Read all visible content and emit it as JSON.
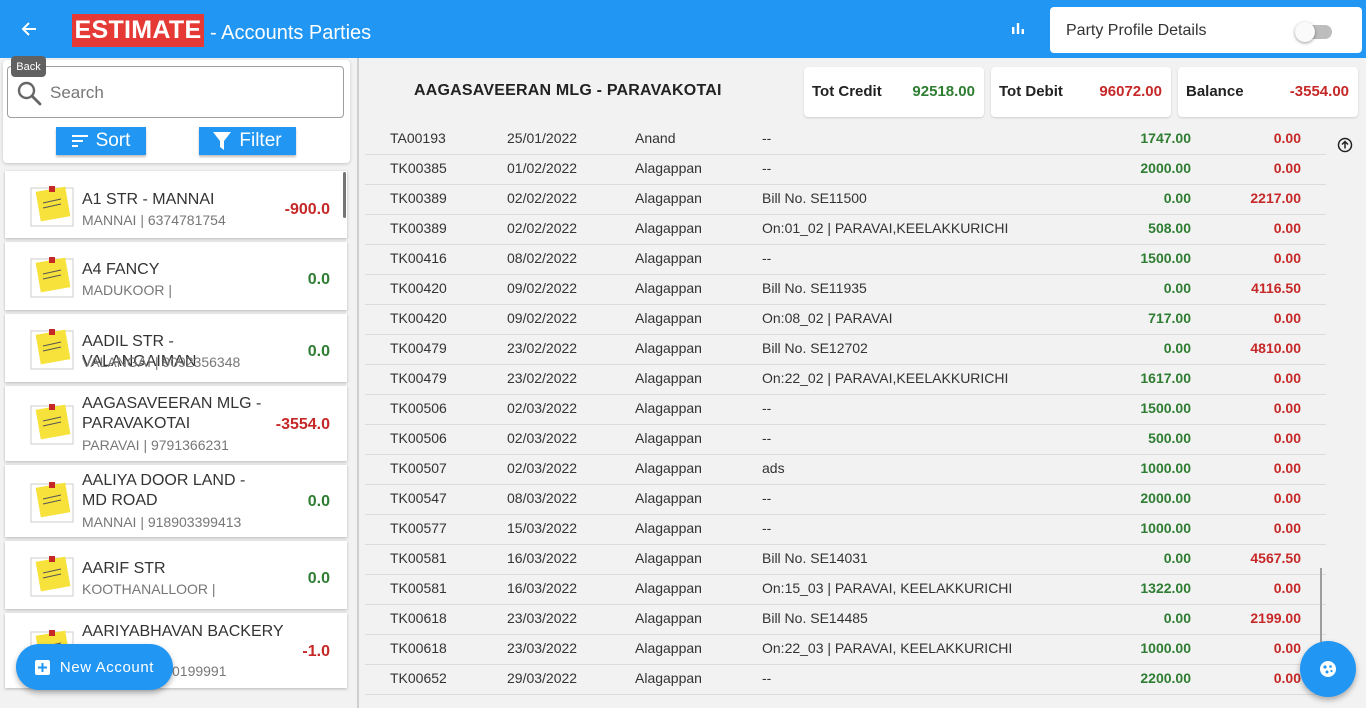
{
  "header": {
    "back_tooltip": "Back",
    "logo_text": "ESTIMATE",
    "title": "- Accounts Parties",
    "profile_toggle_label": "Party Profile Details",
    "profile_toggle_on": false
  },
  "sidebar": {
    "search_placeholder": "Search",
    "sort_label": "Sort",
    "filter_label": "Filter",
    "new_account_label": "New Account",
    "parties": [
      {
        "name": "A1 STR - MANNAI",
        "sub": "MANNAI | 6374781754",
        "amount": "-900.0"
      },
      {
        "name": "A4 FANCY",
        "sub": "MADUKOOR |",
        "amount": "0.0"
      },
      {
        "name": "AADIL STR - VALANGAIMAN",
        "sub": "VALANGAI | 9092356348",
        "amount": "0.0"
      },
      {
        "name": "AAGASAVEERAN MLG - PARAVAKOTAI",
        "sub": "PARAVAI | 9791366231",
        "amount": "-3554.0"
      },
      {
        "name": "AALIYA DOOR LAND - MD ROAD",
        "sub": "MANNAI | 918903399413",
        "amount": "0.0"
      },
      {
        "name": "AARIF STR",
        "sub": "KOOTHANALLOOR |",
        "amount": "0.0"
      },
      {
        "name": "AARIYABHAVAN BACKERY -",
        "sub": "0199991",
        "amount": "-1.0"
      }
    ]
  },
  "account": {
    "name": "AAGASAVEERAN MLG - PARAVAKOTAI",
    "tot_credit_label": "Tot Credit",
    "tot_credit": "92518.00",
    "tot_debit_label": "Tot Debit",
    "tot_debit": "96072.00",
    "balance_label": "Balance",
    "balance": "-3554.00"
  },
  "ledger": [
    {
      "ref": "TA00193",
      "date": "25/01/2022",
      "by": "Anand",
      "desc": "--",
      "credit": "1747.00",
      "debit": "0.00"
    },
    {
      "ref": "TK00385",
      "date": "01/02/2022",
      "by": "Alagappan",
      "desc": "--",
      "credit": "2000.00",
      "debit": "0.00"
    },
    {
      "ref": "TK00389",
      "date": "02/02/2022",
      "by": "Alagappan",
      "desc": "Bill No. SE11500",
      "credit": "0.00",
      "debit": "2217.00"
    },
    {
      "ref": "TK00389",
      "date": "02/02/2022",
      "by": "Alagappan",
      "desc": "On:01_02 | PARAVAI,KEELAKKURICHI",
      "credit": "508.00",
      "debit": "0.00"
    },
    {
      "ref": "TK00416",
      "date": "08/02/2022",
      "by": "Alagappan",
      "desc": "--",
      "credit": "1500.00",
      "debit": "0.00"
    },
    {
      "ref": "TK00420",
      "date": "09/02/2022",
      "by": "Alagappan",
      "desc": "Bill No. SE11935",
      "credit": "0.00",
      "debit": "4116.50"
    },
    {
      "ref": "TK00420",
      "date": "09/02/2022",
      "by": "Alagappan",
      "desc": "On:08_02 | PARAVAI",
      "credit": "717.00",
      "debit": "0.00"
    },
    {
      "ref": "TK00479",
      "date": "23/02/2022",
      "by": "Alagappan",
      "desc": "Bill No. SE12702",
      "credit": "0.00",
      "debit": "4810.00"
    },
    {
      "ref": "TK00479",
      "date": "23/02/2022",
      "by": "Alagappan",
      "desc": "On:22_02 | PARAVAI,KEELAKKURICHI",
      "credit": "1617.00",
      "debit": "0.00"
    },
    {
      "ref": "TK00506",
      "date": "02/03/2022",
      "by": "Alagappan",
      "desc": "--",
      "credit": "1500.00",
      "debit": "0.00"
    },
    {
      "ref": "TK00506",
      "date": "02/03/2022",
      "by": "Alagappan",
      "desc": "--",
      "credit": "500.00",
      "debit": "0.00"
    },
    {
      "ref": "TK00507",
      "date": "02/03/2022",
      "by": "Alagappan",
      "desc": "ads",
      "credit": "1000.00",
      "debit": "0.00"
    },
    {
      "ref": "TK00547",
      "date": "08/03/2022",
      "by": "Alagappan",
      "desc": "--",
      "credit": "2000.00",
      "debit": "0.00"
    },
    {
      "ref": "TK00577",
      "date": "15/03/2022",
      "by": "Alagappan",
      "desc": "--",
      "credit": "1000.00",
      "debit": "0.00"
    },
    {
      "ref": "TK00581",
      "date": "16/03/2022",
      "by": "Alagappan",
      "desc": "Bill No. SE14031",
      "credit": "0.00",
      "debit": "4567.50"
    },
    {
      "ref": "TK00581",
      "date": "16/03/2022",
      "by": "Alagappan",
      "desc": "On:15_03 | PARAVAI, KEELAKKURICHI",
      "credit": "1322.00",
      "debit": "0.00"
    },
    {
      "ref": "TK00618",
      "date": "23/03/2022",
      "by": "Alagappan",
      "desc": "Bill No. SE14485",
      "credit": "0.00",
      "debit": "2199.00"
    },
    {
      "ref": "TK00618",
      "date": "23/03/2022",
      "by": "Alagappan",
      "desc": "On:22_03 | PARAVAI, KEELAKKURICHI",
      "credit": "1000.00",
      "debit": "0.00"
    },
    {
      "ref": "TK00652",
      "date": "29/03/2022",
      "by": "Alagappan",
      "desc": "--",
      "credit": "2200.00",
      "debit": "0.00"
    }
  ],
  "colors": {
    "primary": "#2196f3",
    "logo_red": "#e53935",
    "credit_green": "#2e7d32",
    "debit_red": "#c62828"
  },
  "icons": {
    "back": "arrow-left-icon",
    "chart": "bar-chart-icon",
    "search": "search-icon",
    "sort": "sort-icon",
    "filter": "filter-icon",
    "note": "sticky-note-icon",
    "add": "add-box-icon",
    "scroll_top": "arrow-up-circle-icon",
    "fab": "cookie-icon"
  }
}
